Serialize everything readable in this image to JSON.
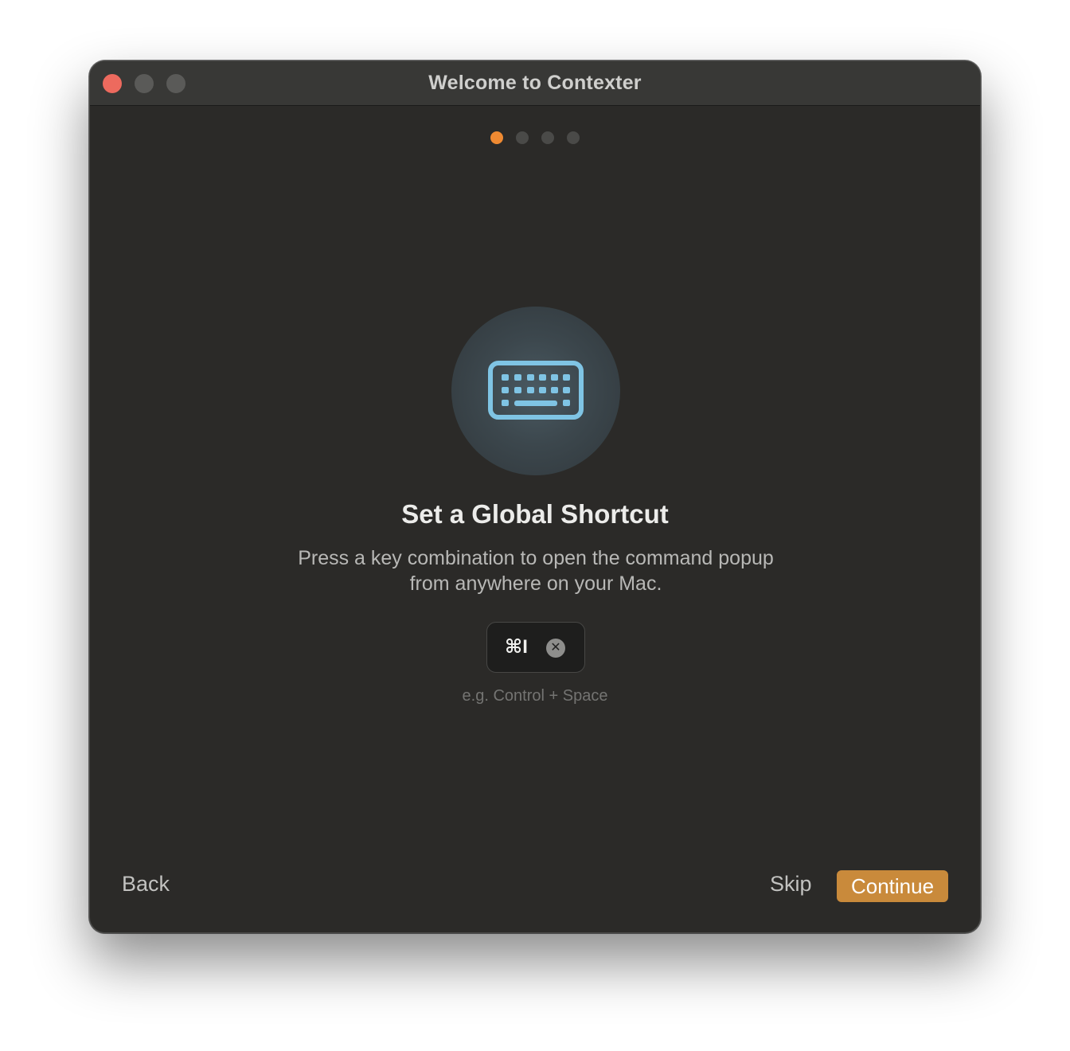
{
  "window": {
    "title": "Welcome to Contexter",
    "traffic_lights": [
      "close",
      "minimize",
      "zoom"
    ]
  },
  "progress": {
    "total_steps": 4,
    "current_step": 1,
    "accent": "#ef8a32"
  },
  "main": {
    "icon": "keyboard-icon",
    "icon_color": "#7fc4e4",
    "heading": "Set a Global Shortcut",
    "description": "Press a key combination to open the command popup from anywhere on your Mac.",
    "shortcut": {
      "value": "⌘I",
      "clear_icon": "xmark-circle-icon",
      "clear_glyph": "✕"
    },
    "hint": "e.g. Control + Space"
  },
  "footer": {
    "back_label": "Back",
    "skip_label": "Skip",
    "continue_label": "Continue",
    "continue_color": "#c98a3b"
  }
}
